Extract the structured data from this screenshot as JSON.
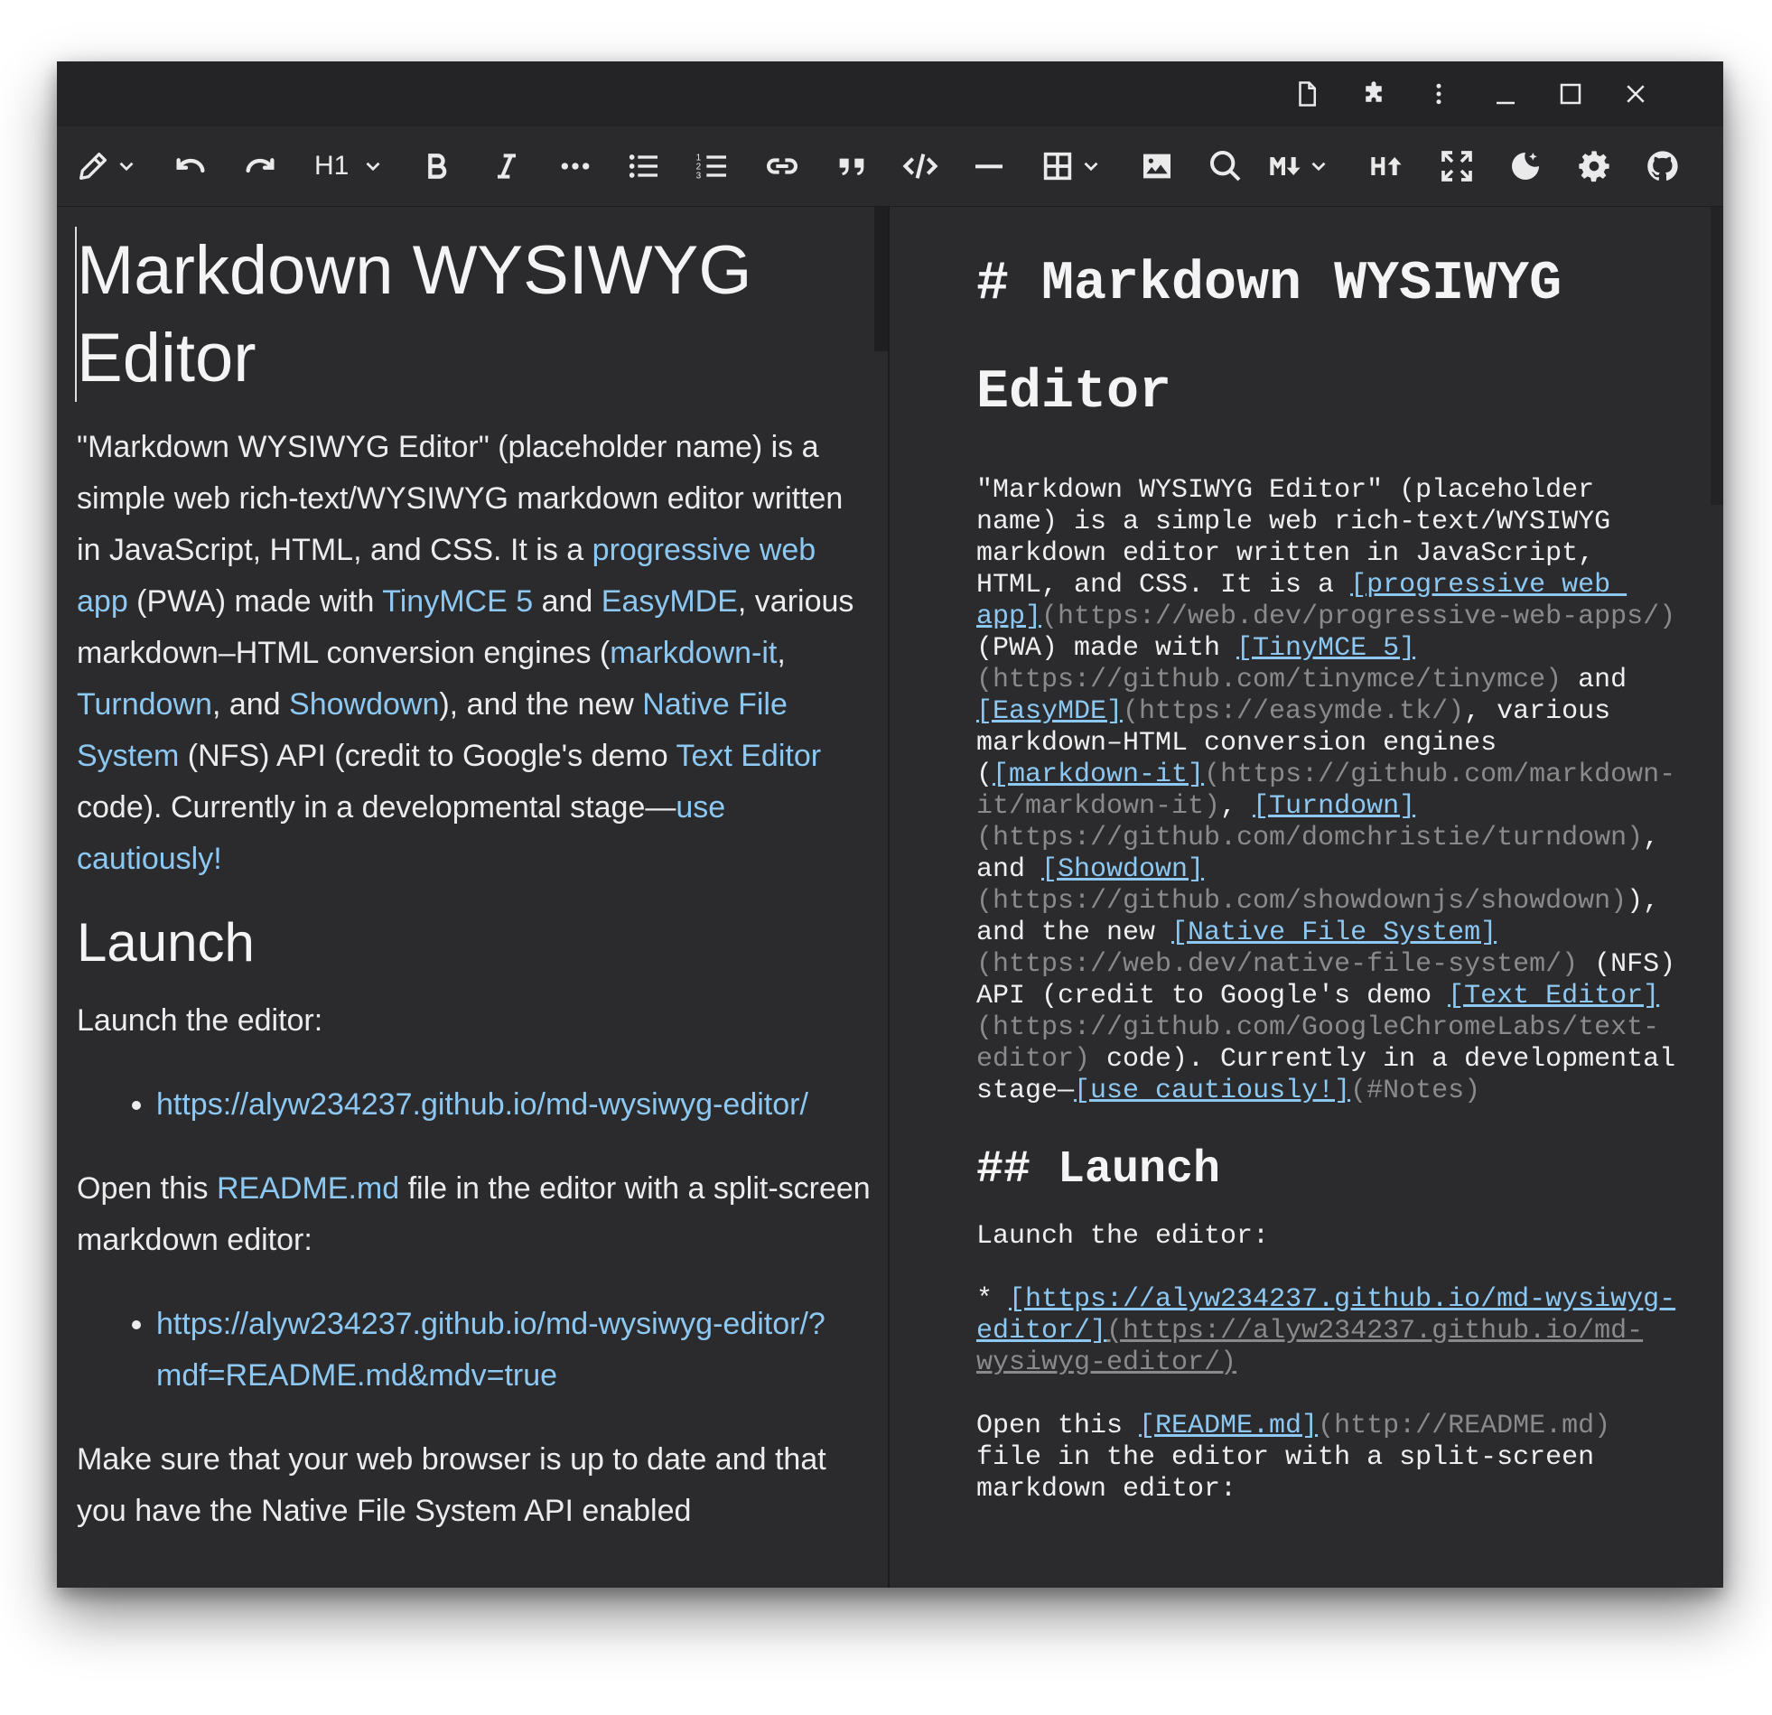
{
  "window": {
    "titlebar_icons": [
      "new-file-icon",
      "extensions-icon",
      "more-vertical-icon",
      "minimize-icon",
      "maximize-icon",
      "close-icon"
    ]
  },
  "toolbar": {
    "heading_label": "H1",
    "tools": [
      "pencil-icon",
      "undo-icon",
      "redo-icon",
      "heading-select",
      "bold-icon",
      "italic-icon",
      "more-horizontal-icon",
      "bullet-list-icon",
      "numbered-list-icon",
      "link-icon",
      "quote-icon",
      "code-icon",
      "horizontal-rule-icon",
      "table-icon",
      "image-icon",
      "search-icon",
      "markdown-down-icon",
      "markdown-up-icon",
      "fullscreen-icon",
      "dark-mode-icon",
      "settings-icon",
      "github-icon"
    ]
  },
  "wysiwyg": {
    "title_line1": "Markdown WYSIWYG",
    "title_line2": "Editor",
    "intro": {
      "t1": "\"Markdown WYSIWYG Editor\" (placeholder name) is a simple web rich-text/WYSIWYG markdown editor written in JavaScript, HTML, and CSS. It is a ",
      "l1": "progressive web app",
      "t2": " (PWA) made with ",
      "l2": "TinyMCE 5",
      "t3": " and ",
      "l3": "EasyMDE",
      "t4": ", various markdown–HTML conversion engines (",
      "l4": "markdown-it",
      "t5": ", ",
      "l5": "Turndown",
      "t6": ", and ",
      "l6": "Showdown",
      "t7": "), and the new ",
      "l7": "Native File System",
      "t8": " (NFS) API (credit to Google's demo ",
      "l8": "Text Editor",
      "t9": " code). Currently in a developmental stage—",
      "l9": "use cautiously!"
    },
    "launch_heading": "Launch",
    "launch_text": "Launch the editor:",
    "launch_link": "https://alyw234237.github.io/md-wysiwyg-editor/",
    "open_t1": "Open this ",
    "open_link": "README.md",
    "open_t2": " file in the editor with a split-screen markdown editor:",
    "split_link": "https://alyw234237.github.io/md-wysiwyg-editor/?mdf=README.md&mdv=true",
    "make_sure": "Make sure that your web browser is up to date and that you have the Native File System API enabled"
  },
  "markdown": {
    "h1_line1": "# Markdown WYSIWYG",
    "h1_line2": "Editor",
    "r1": "\"Markdown WYSIWYG Editor\" (placeholder",
    "r2": "name) is a simple web rich-text/WYSIWYG",
    "r3": "markdown editor written in JavaScript,",
    "r4a": "HTML, and CSS. It is a ",
    "r4l": "[progressive web ",
    "r5l": "app]",
    "r5u": "(https://web.dev/progressive-web-apps/)",
    "r6a": "(PWA) made with ",
    "r6l": "[TinyMCE 5]",
    "r7u": "(https://github.com/tinymce/tinymce)",
    "r7b": " and",
    "r8l": "[EasyMDE]",
    "r8u": "(https://easymde.tk/)",
    "r8b": ", various",
    "r9": "markdown–HTML conversion engines",
    "r10a": "(",
    "r10l": "[markdown-it]",
    "r10u": "(https://github.com/markdown-",
    "r11u": "it/markdown-it)",
    "r11b": ", ",
    "r11l": "[Turndown]",
    "r12u": "(https://github.com/domchristie/turndown)",
    "r12b": ",",
    "r13a": "and ",
    "r13l": "[Showdown]",
    "r14u": "(https://github.com/showdownjs/showdown)",
    "r14b": "),",
    "r15a": "and the new ",
    "r15l": "[Native File System]",
    "r16u": "(https://web.dev/native-file-system/)",
    "r16b": " (NFS)",
    "r17a": "API (credit to Google's demo ",
    "r17l": "[Text Editor]",
    "r18u": "(https://github.com/GoogleChromeLabs/text-",
    "r19u": "editor)",
    "r19b": " code). Currently in a developmental",
    "r20a": "stage—",
    "r20l": "[use cautiously!]",
    "r20u": "(#Notes)",
    "h2": "## Launch",
    "launch_text": "Launch the editor:",
    "b1a": "* ",
    "b1l": "[https://alyw234237.github.io/md-wysiwyg-",
    "b2l": "editor/]",
    "b2u": "(https://alyw234237.github.io/md-",
    "b3u": "wysiwyg-editor/)",
    "o1a": "Open this ",
    "o1l": "[README.md]",
    "o1u": "(http://README.md)",
    "o2": "file in the editor with a split-screen",
    "o3": "markdown editor:"
  }
}
